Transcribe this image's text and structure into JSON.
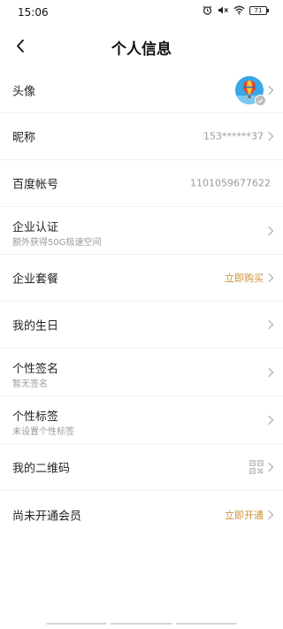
{
  "status_bar": {
    "time": "15:06",
    "battery": "71"
  },
  "header": {
    "title": "个人信息"
  },
  "rows": {
    "avatar": {
      "label": "头像"
    },
    "nickname": {
      "label": "昵称",
      "value": "153******37"
    },
    "baidu_account": {
      "label": "百度帐号",
      "value": "1101059677622"
    },
    "enterprise_cert": {
      "label": "企业认证",
      "sub": "额外获得50G极速空间"
    },
    "enterprise_plan": {
      "label": "企业套餐",
      "value": "立即购买"
    },
    "birthday": {
      "label": "我的生日"
    },
    "signature": {
      "label": "个性签名",
      "sub": "暂无签名"
    },
    "tags": {
      "label": "个性标签",
      "sub": "未设置个性标签"
    },
    "qrcode": {
      "label": "我的二维码"
    },
    "membership": {
      "label": "尚未开通会员",
      "value": "立即开通"
    }
  },
  "colors": {
    "accent": "#c8913a",
    "secondary_text": "#9a9a9a",
    "divider": "#f2f2f2"
  },
  "icons": {
    "back": "back-arrow-icon",
    "chevron": "chevron-right-icon",
    "qr": "qr-code-icon",
    "avatar_badge": "verified-check-icon"
  }
}
